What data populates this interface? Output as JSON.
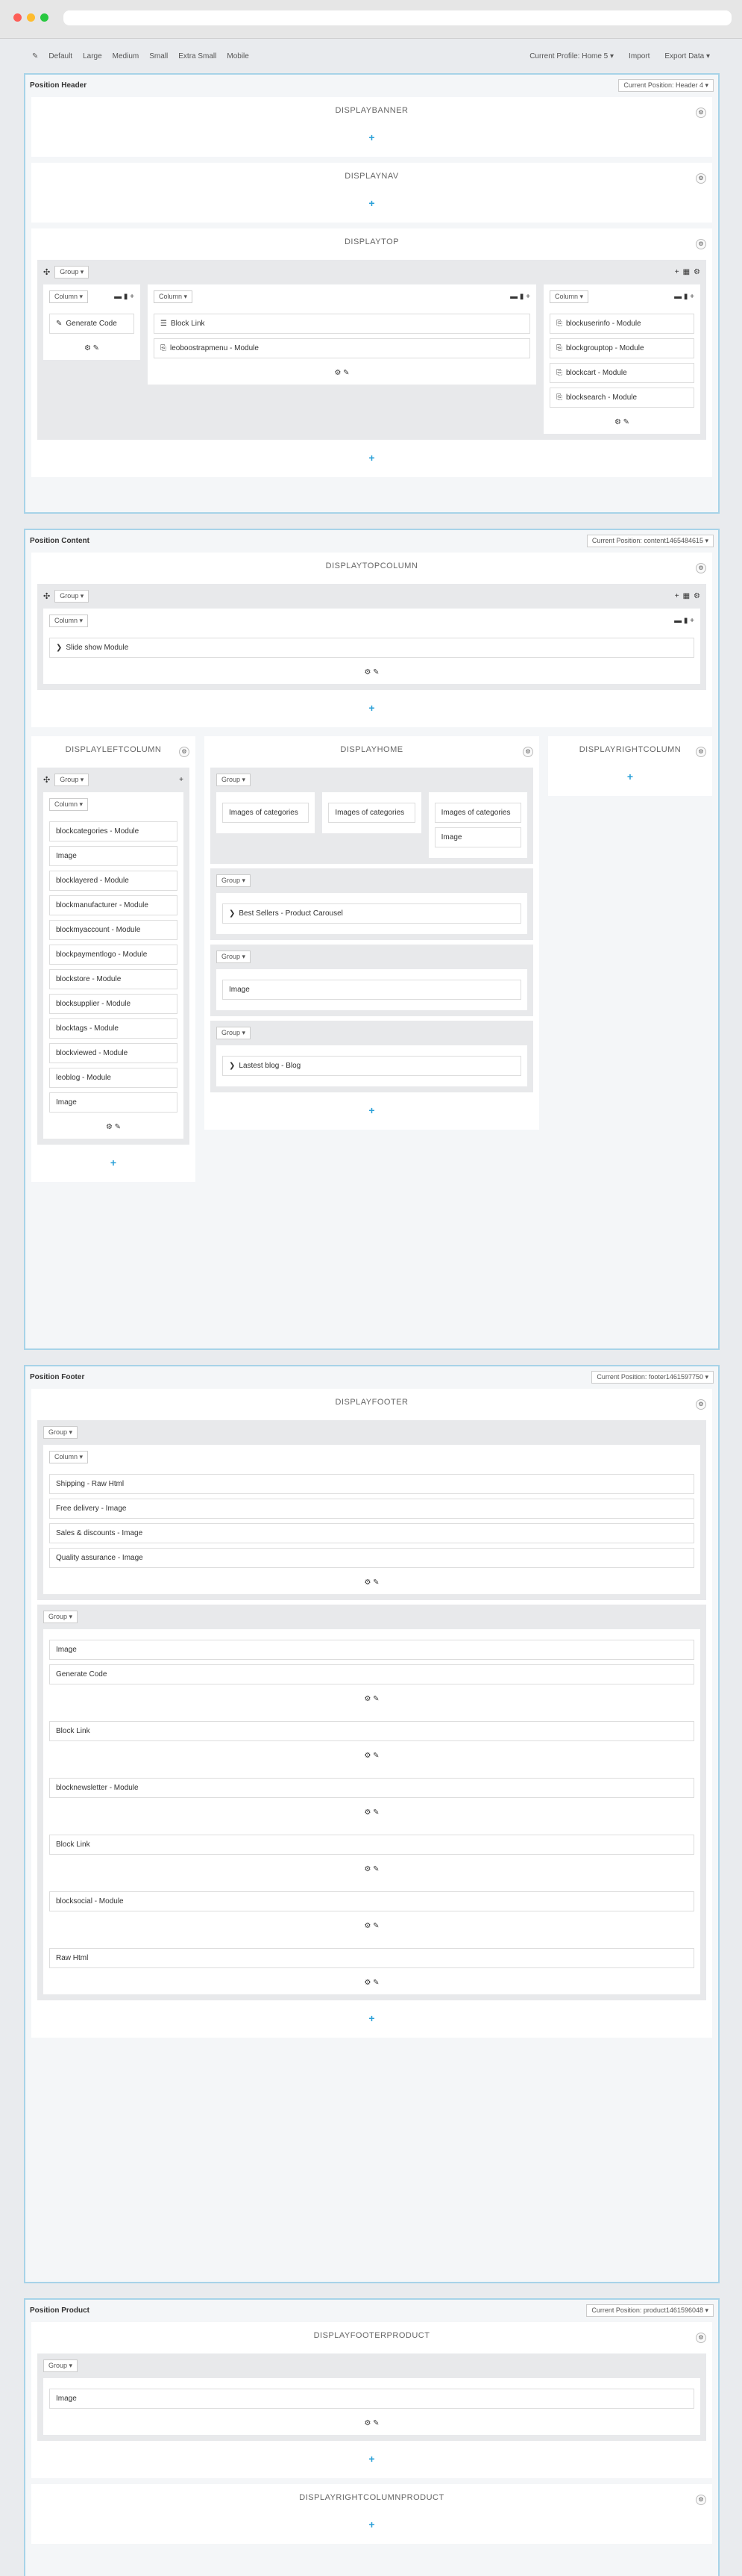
{
  "toolbar": {
    "items": [
      "Default",
      "Large",
      "Medium",
      "Small",
      "Extra Small",
      "Mobile"
    ],
    "profile": "Current Profile: Home 5 ▾",
    "import": "Import",
    "export": "Export Data ▾"
  },
  "header": {
    "label": "Position Header",
    "current": "Current Position: Header 4 ▾",
    "banner": "DISPLAYBANNER",
    "nav": "DISPLAYNAV",
    "top": "DISPLAYTOP",
    "cols": [
      [
        "Generate Code"
      ],
      [
        "Block Link",
        "leoboostrapmenu - Module"
      ],
      [
        "blockuserinfo - Module",
        "blockgrouptop - Module",
        "blockcart - Module",
        "blocksearch - Module"
      ]
    ]
  },
  "content": {
    "label": "Position Content",
    "current": "Current Position: content1465484615 ▾",
    "topcol": "DISPLAYTOPCOLUMN",
    "slideshow": "Slide show Module",
    "left": "DISPLAYLEFTCOLUMN",
    "home": "DISPLAYHOME",
    "right": "DISPLAYRIGHTCOLUMN",
    "leftmods": [
      "blockcategories - Module",
      "Image",
      "blocklayered - Module",
      "blockmanufacturer - Module",
      "blockmyaccount - Module",
      "blockpaymentlogo - Module",
      "blockstore - Module",
      "blocksupplier - Module",
      "blocktags - Module",
      "blockviewed - Module",
      "leoblog - Module",
      "Image"
    ],
    "cat": "Images of categories",
    "img": "Image",
    "bestsellers": "Best Sellers - Product Carousel",
    "blog": "Lastest blog - Blog"
  },
  "footer": {
    "label": "Position Footer",
    "current": "Current Position: footer1461597750 ▾",
    "title": "DISPLAYFOOTER",
    "g1": [
      "Shipping - Raw Html",
      "Free delivery - Image",
      "Sales & discounts - Image",
      "Quality assurance - Image"
    ],
    "g2": [
      [
        "Image",
        "Generate Code"
      ],
      [
        "Block Link"
      ],
      [
        "blocknewsletter - Module"
      ],
      [
        "Block Link"
      ],
      [
        "blocksocial - Module"
      ],
      [
        "Raw Html"
      ]
    ]
  },
  "product": {
    "label": "Position Product",
    "current": "Current Position: product1461596048 ▾",
    "footerprod": "DISPLAYFOOTERPRODUCT",
    "img": "Image",
    "rightprod": "DISPLAYRIGHTCOLUMNPRODUCT"
  },
  "common": {
    "group": "Group ▾",
    "column": "Column ▾"
  }
}
